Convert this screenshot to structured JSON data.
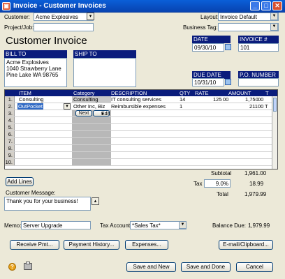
{
  "window": {
    "title": "Invoice - Customer Invoices"
  },
  "header": {
    "customer_label": "Customer:",
    "customer_value": "Acme Explosives",
    "project_label": "Project/Job:",
    "layout_label": "Layout:",
    "layout_value": "Invoice Default",
    "business_tag_label": "Business Tag:"
  },
  "invoice_title": "Customer Invoice",
  "date": {
    "label": "DATE",
    "value": "09/30/10"
  },
  "invoice_no": {
    "label": "INVOICE #",
    "value": "101"
  },
  "bill_to": {
    "label": "BILL TO",
    "lines": [
      "Acme Explosives",
      "1040 Strawberry Lane",
      "Pine Lake WA 98765"
    ]
  },
  "ship_to": {
    "label": "SHIP TO"
  },
  "due_date": {
    "label": "DUE DATE",
    "value": "10/31/10"
  },
  "po_number": {
    "label": "P.O. NUMBER"
  },
  "grid": {
    "columns": [
      "ITEM",
      "Category",
      "DESCRIPTION",
      "QTY",
      "RATE",
      "AMOUNT",
      "T"
    ],
    "rows": [
      {
        "num": "1.",
        "item": "Consulting",
        "category": "Consulting",
        "description": "IT consulting services",
        "qty": "14",
        "rate": "125",
        "rate_c": "00",
        "amount": "1,750",
        "amount_c": "00",
        "t": ""
      },
      {
        "num": "2.",
        "item": "OutPocket",
        "category": "Other Inc, Biz",
        "description": "Reimbursible expenses",
        "qty": "1",
        "rate": "",
        "rate_c": "",
        "amount": "211",
        "amount_c": "00",
        "t": "T"
      },
      {
        "num": "3."
      },
      {
        "num": "4."
      },
      {
        "num": "5."
      },
      {
        "num": "6."
      },
      {
        "num": "7."
      },
      {
        "num": "8."
      },
      {
        "num": "9."
      },
      {
        "num": "10."
      }
    ],
    "next_label": "Next",
    "edit_label": "Edit"
  },
  "add_lines_label": "Add Lines",
  "totals": {
    "subtotal_label": "Subtotal",
    "subtotal_value": "1,961.00",
    "tax_label": "Tax",
    "tax_rate": "9.0%",
    "tax_value": "18.99",
    "total_label": "Total",
    "total_value": "1,979.99"
  },
  "message": {
    "label": "Customer Message:",
    "value": "Thank you for your business!"
  },
  "memo": {
    "label": "Memo:",
    "value": "Server Upgrade"
  },
  "tax_account": {
    "label": "Tax Account:",
    "value": "*Sales Tax*"
  },
  "balance_due": {
    "label": "Balance Due:",
    "value": "1,979.99"
  },
  "buttons": {
    "receive_pmt": "Receive Pmt...",
    "payment_history": "Payment History...",
    "expenses": "Expenses...",
    "email_clipboard": "E-mail/Clipboard...",
    "save_new": "Save and New",
    "save_done": "Save and Done",
    "cancel": "Cancel"
  },
  "icons": {
    "help": "help-icon",
    "print": "printer-icon"
  }
}
